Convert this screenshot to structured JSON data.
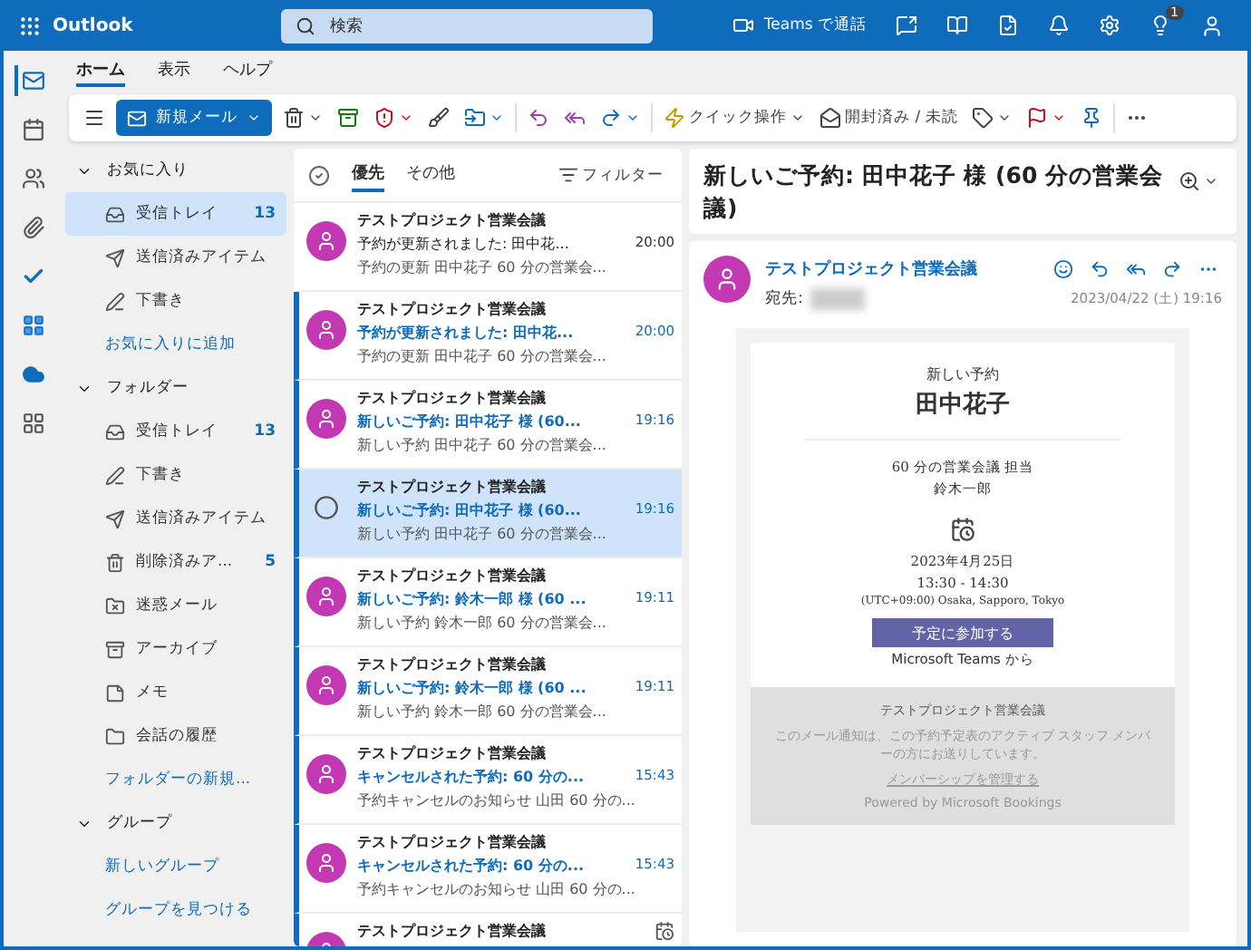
{
  "topbar": {
    "app_name": "Outlook",
    "search_placeholder": "検索",
    "teams_call": "Teams で通話",
    "notification_count": "1"
  },
  "ribbon_tabs": [
    {
      "label": "ホーム",
      "selected": true
    },
    {
      "label": "表示",
      "selected": false
    },
    {
      "label": "ヘルプ",
      "selected": false
    }
  ],
  "toolbar": {
    "new_mail": "新規メール",
    "quick_steps": "クイック操作",
    "read_unread": "開封済み / 未読"
  },
  "folder_sections": [
    {
      "title": "お気に入り",
      "expanded": true,
      "items": [
        {
          "kind": "inbox",
          "label": "受信トレイ",
          "count": "13",
          "selected": true
        },
        {
          "kind": "sent",
          "label": "送信済みアイテム",
          "selected": false
        },
        {
          "kind": "drafts",
          "label": "下書き",
          "selected": false
        },
        {
          "kind": "link",
          "label": "お気に入りに追加",
          "selected": false
        }
      ]
    },
    {
      "title": "フォルダー",
      "expanded": true,
      "items": [
        {
          "kind": "inbox",
          "label": "受信トレイ",
          "count": "13",
          "selected": false
        },
        {
          "kind": "drafts",
          "label": "下書き",
          "selected": false
        },
        {
          "kind": "sent",
          "label": "送信済みアイテム",
          "selected": false
        },
        {
          "kind": "deleted",
          "label": "削除済みア...",
          "count": "5",
          "selected": false
        },
        {
          "kind": "junk",
          "label": "迷惑メール",
          "selected": false
        },
        {
          "kind": "archive",
          "label": "アーカイブ",
          "selected": false
        },
        {
          "kind": "notes",
          "label": "メモ",
          "selected": false
        },
        {
          "kind": "history",
          "label": "会話の履歴",
          "selected": false
        },
        {
          "kind": "link",
          "label": "フォルダーの新規...",
          "selected": false
        }
      ]
    },
    {
      "title": "グループ",
      "expanded": true,
      "items": [
        {
          "kind": "link",
          "label": "新しいグループ",
          "selected": false
        },
        {
          "kind": "link",
          "label": "グループを見つける",
          "selected": false
        }
      ]
    }
  ],
  "list_tabs": [
    {
      "label": "優先",
      "selected": true
    },
    {
      "label": "その他",
      "selected": false
    }
  ],
  "filter": "フィルター",
  "messages": [
    {
      "sender": "テストプロジェクト営業会議",
      "subject": "予約が更新されました: 田中花...",
      "time": "20:00",
      "preview": "予約の更新 田中花子 60 分の営業会...",
      "unread": false,
      "selected": false
    },
    {
      "sender": "テストプロジェクト営業会議",
      "subject": "予約が更新されました: 田中花...",
      "time": "20:00",
      "preview": "予約の更新 田中花子 60 分の営業会...",
      "unread": true,
      "selected": false
    },
    {
      "sender": "テストプロジェクト営業会議",
      "subject": "新しいご予約: 田中花子 様 (60...",
      "time": "19:16",
      "preview": "新しい予約 田中花子 60 分の営業会...",
      "unread": true,
      "selected": false
    },
    {
      "sender": "テストプロジェクト営業会議",
      "subject": "新しいご予約: 田中花子 様 (60...",
      "time": "19:16",
      "preview": "新しい予約 田中花子 60 分の営業会...",
      "unread": true,
      "selected": true
    },
    {
      "sender": "テストプロジェクト営業会議",
      "subject": "新しいご予約: 鈴木一郎 様 (60 ...",
      "time": "19:11",
      "preview": "新しい予約 鈴木一郎 60 分の営業会...",
      "unread": true,
      "selected": false
    },
    {
      "sender": "テストプロジェクト営業会議",
      "subject": "新しいご予約: 鈴木一郎 様 (60 ...",
      "time": "19:11",
      "preview": "新しい予約 鈴木一郎 60 分の営業会...",
      "unread": true,
      "selected": false
    },
    {
      "sender": "テストプロジェクト営業会議",
      "subject": "キャンセルされた予約: 60 分の...",
      "time": "15:43",
      "preview": "予約キャンセルのお知らせ 山田 60 分の...",
      "unread": true,
      "selected": false
    },
    {
      "sender": "テストプロジェクト営業会議",
      "subject": "キャンセルされた予約: 60 分の...",
      "time": "15:43",
      "preview": "予約キャンセルのお知らせ 山田 60 分の...",
      "unread": true,
      "selected": false
    },
    {
      "sender": "テストプロジェクト営業会議",
      "unread": true,
      "selected": false
    }
  ],
  "reading": {
    "subject": "新しいご予約: 田中花子 様 (60 分の営業会議)",
    "sender": "テストプロジェクト営業会議",
    "to_label": "宛先:",
    "date": "2023/04/22 (土) 19:16",
    "body": {
      "label": "新しい予約",
      "customer": "田中花子",
      "service": "60 分の営業会議 担当",
      "staff": "鈴木一郎",
      "date": "2023年4月25日",
      "time": "13:30 - 14:30",
      "timezone": "(UTC+09:00) Osaka, Sapporo, Tokyo",
      "join_button": "予定に参加する",
      "teams_note": "Microsoft Teams から",
      "business": "テストプロジェクト営業会議",
      "notice": "このメール通知は、この予約予定表のアクティブ スタッフ メンバーの方にお送りしています。",
      "manage_link": "メンバーシップを管理する",
      "powered": "Powered by Microsoft Bookings"
    }
  }
}
